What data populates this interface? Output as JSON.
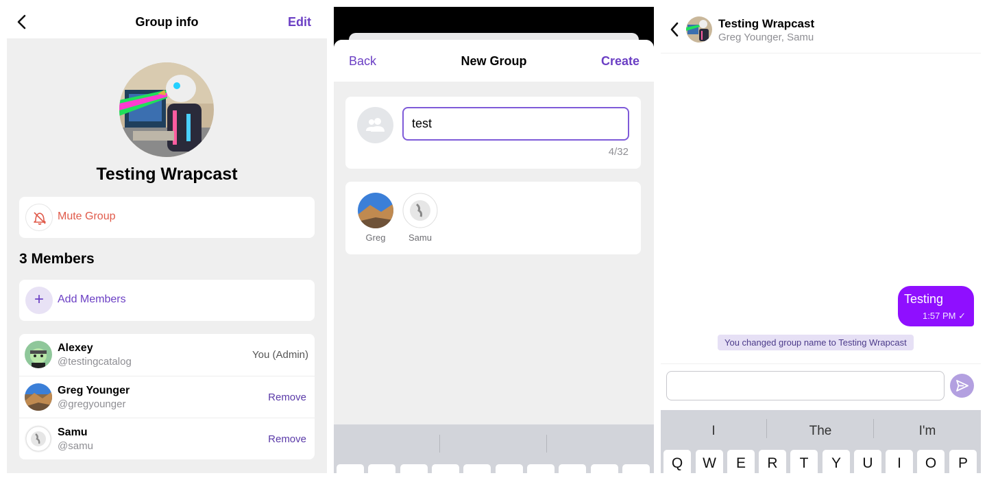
{
  "group_info": {
    "title": "Group info",
    "edit_label": "Edit",
    "group_name": "Testing Wrapcast",
    "mute_label": "Mute Group",
    "members_heading": "3 Members",
    "add_members_label": "Add Members",
    "members": [
      {
        "name": "Alexey",
        "handle": "@testingcatalog",
        "action": "You (Admin)"
      },
      {
        "name": "Greg Younger",
        "handle": "@gregyounger",
        "action": "Remove"
      },
      {
        "name": "Samu",
        "handle": "@samu",
        "action": "Remove"
      }
    ]
  },
  "new_group": {
    "back_label": "Back",
    "title": "New Group",
    "create_label": "Create",
    "name_value": "test",
    "counter": "4/32",
    "selected": [
      {
        "name": "Greg"
      },
      {
        "name": "Samu"
      }
    ]
  },
  "chat": {
    "title": "Testing Wrapcast",
    "subtitle": "Greg Younger, Samu",
    "message_text": "Testing",
    "message_time": "1:57 PM",
    "system_message": "You changed group name to Testing Wrapcast",
    "suggestions": [
      "I",
      "The",
      "I'm"
    ],
    "keys": [
      "Q",
      "W",
      "E",
      "R",
      "T",
      "Y",
      "U",
      "I",
      "O",
      "P"
    ]
  },
  "colors": {
    "accent": "#6b3fc4",
    "bubble": "#8f0fff",
    "mute_red": "#e05a4a"
  }
}
